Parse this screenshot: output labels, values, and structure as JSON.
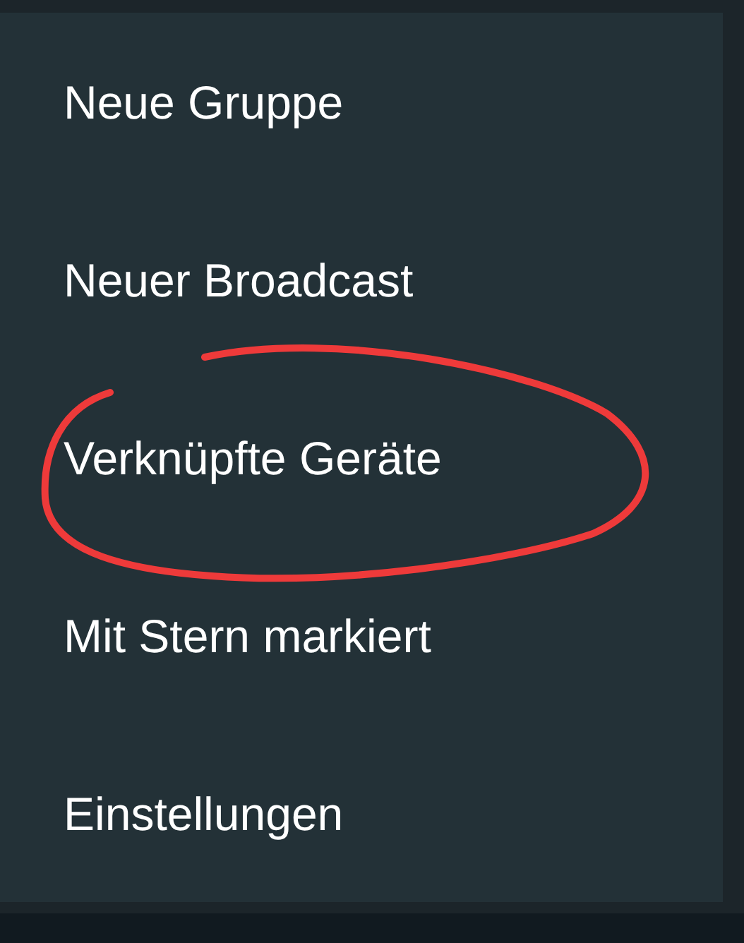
{
  "menu": {
    "items": [
      {
        "label": "Neue Gruppe",
        "circled": false
      },
      {
        "label": "Neuer Broadcast",
        "circled": false
      },
      {
        "label": "Verknüpfte Geräte",
        "circled": true
      },
      {
        "label": "Mit Stern markiert",
        "circled": false
      },
      {
        "label": "Einstellungen",
        "circled": false
      }
    ]
  }
}
